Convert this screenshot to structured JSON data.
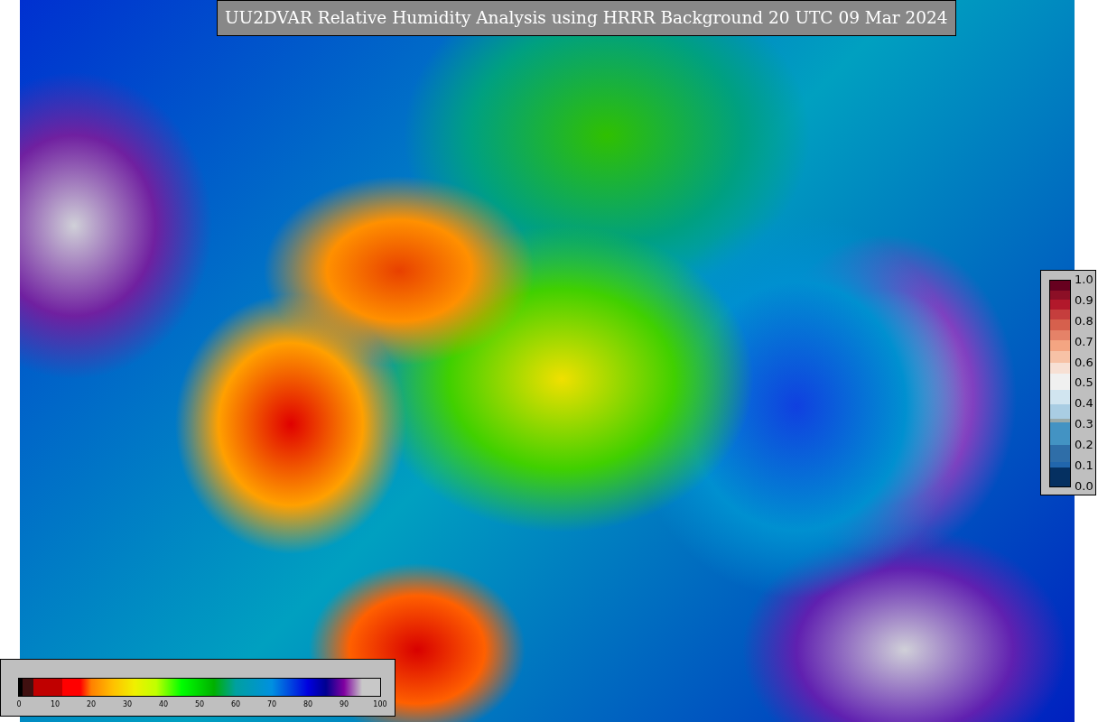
{
  "title": "UU2DVAR Relative Humidity Analysis using HRRR Background 20 UTC 09 Mar 2024",
  "observation_colorbar": {
    "ticks": [
      "1.0",
      "0.9",
      "0.8",
      "0.7",
      "0.6",
      "0.5",
      "0.4",
      "0.3",
      "0.2",
      "0.1",
      "0.0"
    ]
  },
  "humidity_colorbar": {
    "ticks": [
      "0",
      "10",
      "20",
      "30",
      "40",
      "50",
      "60",
      "70",
      "80",
      "90",
      "100"
    ]
  }
}
